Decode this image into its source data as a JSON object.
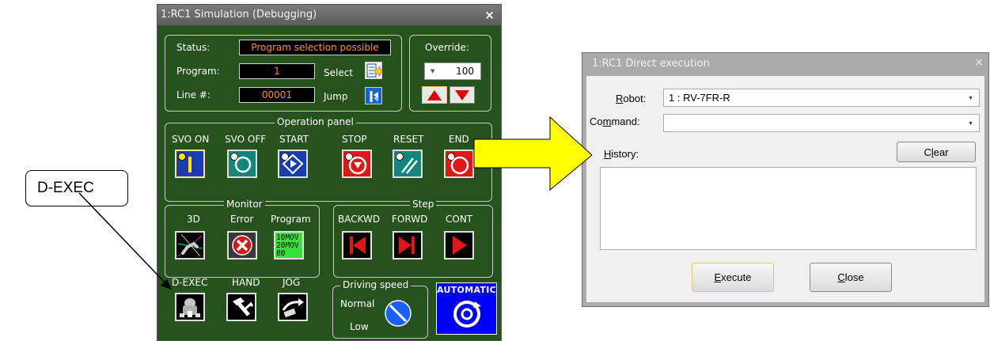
{
  "callout": {
    "label": "D-EXEC"
  },
  "sim": {
    "title": "1:RC1 Simulation (Debugging)",
    "close": "×",
    "status": {
      "label": "Status:",
      "value": "Program selection possible"
    },
    "program": {
      "label": "Program:",
      "value": "1",
      "select_label": "Select"
    },
    "line": {
      "label": "Line #:",
      "value": "00001",
      "jump_label": "Jump"
    },
    "override": {
      "label": "Override:",
      "value": "100",
      "caret": "▼"
    },
    "operation_panel": {
      "title": "Operation panel",
      "buttons": [
        {
          "label": "SVO ON"
        },
        {
          "label": "SVO OFF"
        },
        {
          "label": "START"
        },
        {
          "label": "STOP"
        },
        {
          "label": "RESET"
        },
        {
          "label": "END"
        }
      ]
    },
    "monitor": {
      "title": "Monitor",
      "items": [
        {
          "label": "3D"
        },
        {
          "label": "Error"
        },
        {
          "label": "Program"
        }
      ],
      "program_preview": [
        "10MOV",
        "20MOV",
        "80 ••••"
      ]
    },
    "step": {
      "title": "Step",
      "items": [
        {
          "label": "BACKWD"
        },
        {
          "label": "FORWD"
        },
        {
          "label": "CONT"
        }
      ]
    },
    "tools": [
      {
        "label": "D-EXEC"
      },
      {
        "label": "HAND"
      },
      {
        "label": "JOG"
      }
    ],
    "driving_speed": {
      "title": "Driving speed",
      "normal": "Normal",
      "low": "Low"
    },
    "automatic": {
      "label": "AUTOMATIC"
    }
  },
  "dx": {
    "title": "1:RC1  Direct execution",
    "close": "×",
    "robot": {
      "label_pre": "",
      "label_u": "R",
      "label_post": "obot:",
      "value": "1 : RV-7FR-R"
    },
    "command": {
      "label_pre": "Co",
      "label_u": "m",
      "label_post": "mand:",
      "value": ""
    },
    "history": {
      "label_pre": "",
      "label_u": "H",
      "label_post": "istory:"
    },
    "clear": {
      "label_pre": "C",
      "label_u": "l",
      "label_post": "ear"
    },
    "execute": {
      "label_pre": "",
      "label_u": "E",
      "label_post": "xecute"
    },
    "close_button": {
      "label_pre": "",
      "label_u": "C",
      "label_post": "lose"
    },
    "caret": "▼"
  },
  "colors": {
    "sim_bg": "#26521d",
    "value_text": "#ff8a1c",
    "arrow_fill": "#ffff00",
    "automatic_bg": "#0000ff"
  },
  "icons": {
    "svo-on": "power-toggle-icon",
    "svo-off": "circle-off-icon",
    "start": "start-diamond-icon",
    "stop": "stop-icon",
    "reset": "reset-slash-icon",
    "end": "end-circle-icon",
    "3d": "robot-3d-icon",
    "error": "error-x-icon",
    "backwd": "step-backward-icon",
    "forwd": "step-forward-icon",
    "cont": "continue-play-icon",
    "d-exec": "robot-direct-exec-icon",
    "hand": "hand-gripper-icon",
    "jog": "jog-icon"
  }
}
